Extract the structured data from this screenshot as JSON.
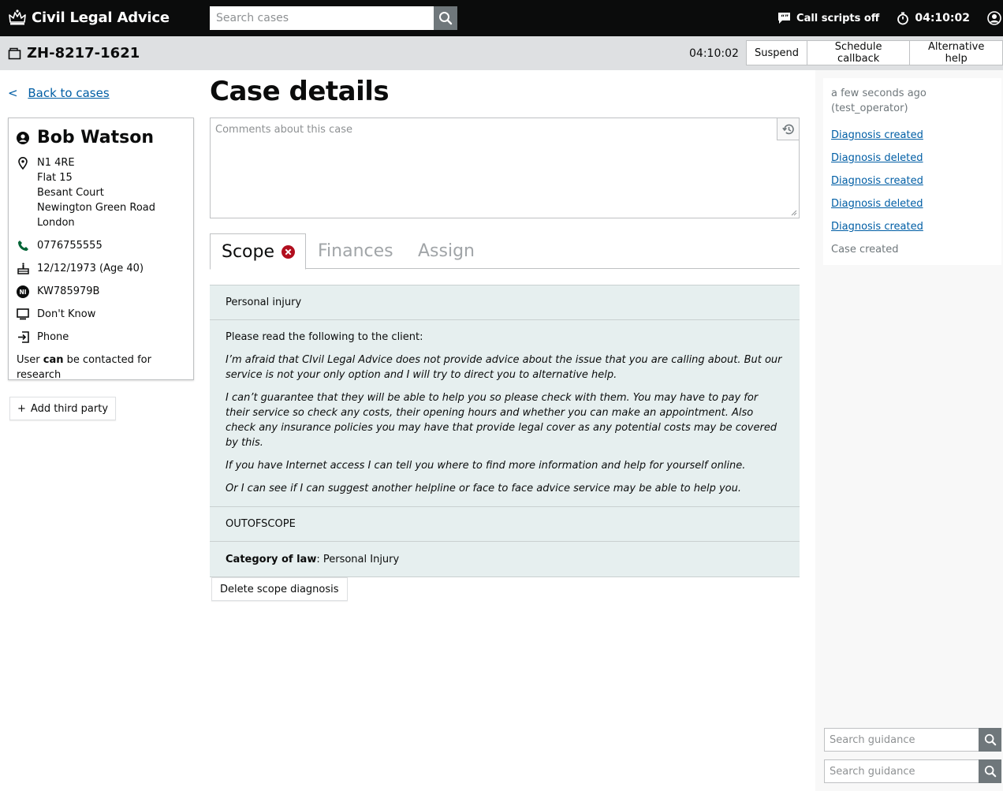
{
  "header": {
    "title": "Civil Legal Advice",
    "search_placeholder": "Search cases",
    "call_scripts_label": "Call scripts off",
    "timer": "04:10:02"
  },
  "case_bar": {
    "reference": "ZH-8217-1621",
    "timer": "04:10:02",
    "actions": [
      "Suspend",
      "Schedule callback",
      "Alternative help"
    ]
  },
  "sidebar": {
    "back_chevron": "<",
    "back_label": "Back to cases",
    "person": {
      "name": "Bob Watson",
      "address": [
        "N1 4RE",
        "Flat 15",
        "Besant Court",
        "Newington Green Road",
        "London"
      ],
      "phone": "0776755555",
      "dob": "12/12/1973 (Age 40)",
      "ni_number": "KW785979B",
      "ni_badge": "NI",
      "media": "Don't Know",
      "contact_method": "Phone",
      "research_prefix": "User",
      "research_can": "can",
      "research_suffix": "be contacted for research"
    },
    "add_third_party_plus": "+",
    "add_third_party_label": "Add third party"
  },
  "main": {
    "title": "Case details",
    "comments_placeholder": "Comments about this case",
    "tabs": [
      {
        "label": "Scope",
        "active": true
      },
      {
        "label": "Finances",
        "active": false
      },
      {
        "label": "Assign",
        "active": false
      }
    ],
    "scope": {
      "category": "Personal injury",
      "intro": "Please read the following to the client:",
      "paragraphs": [
        "I’m afraid that CIvil Legal Advice does not provide advice about the issue that you are calling about. But our service is not your only option and I will try to direct you to alternative help.",
        "I can’t guarantee that they will be able to help you so please check with them. You may have to pay for their service so check any costs, their opening hours and whether you can make an appointment. Also check any insurance policies you may have that provide legal cover as any potential costs may be covered by this.",
        "If you have Internet access I can tell you where to find more information and help for yourself online.",
        "Or I can see if I can suggest another helpline or face to face advice service may be able to help you."
      ],
      "outcome": "OUTOFSCOPE",
      "category_label": "Category of law",
      "category_value": ": Personal Injury"
    },
    "delete_label": "Delete scope diagnosis"
  },
  "activity": {
    "time": "a few seconds ago",
    "user": "(test_operator)",
    "items": [
      "Diagnosis created",
      "Diagnosis deleted",
      "Diagnosis created",
      "Diagnosis deleted",
      "Diagnosis created",
      "Case created"
    ]
  },
  "guidance": {
    "placeholder_1": "Search guidance",
    "placeholder_2": "Search guidance"
  },
  "colors": {
    "header_bg": "#0b0c0c",
    "link": "#005ea5",
    "phone_icon": "#006435",
    "error_red": "#b10e1e",
    "scope_panel_bg": "#e6efef"
  }
}
